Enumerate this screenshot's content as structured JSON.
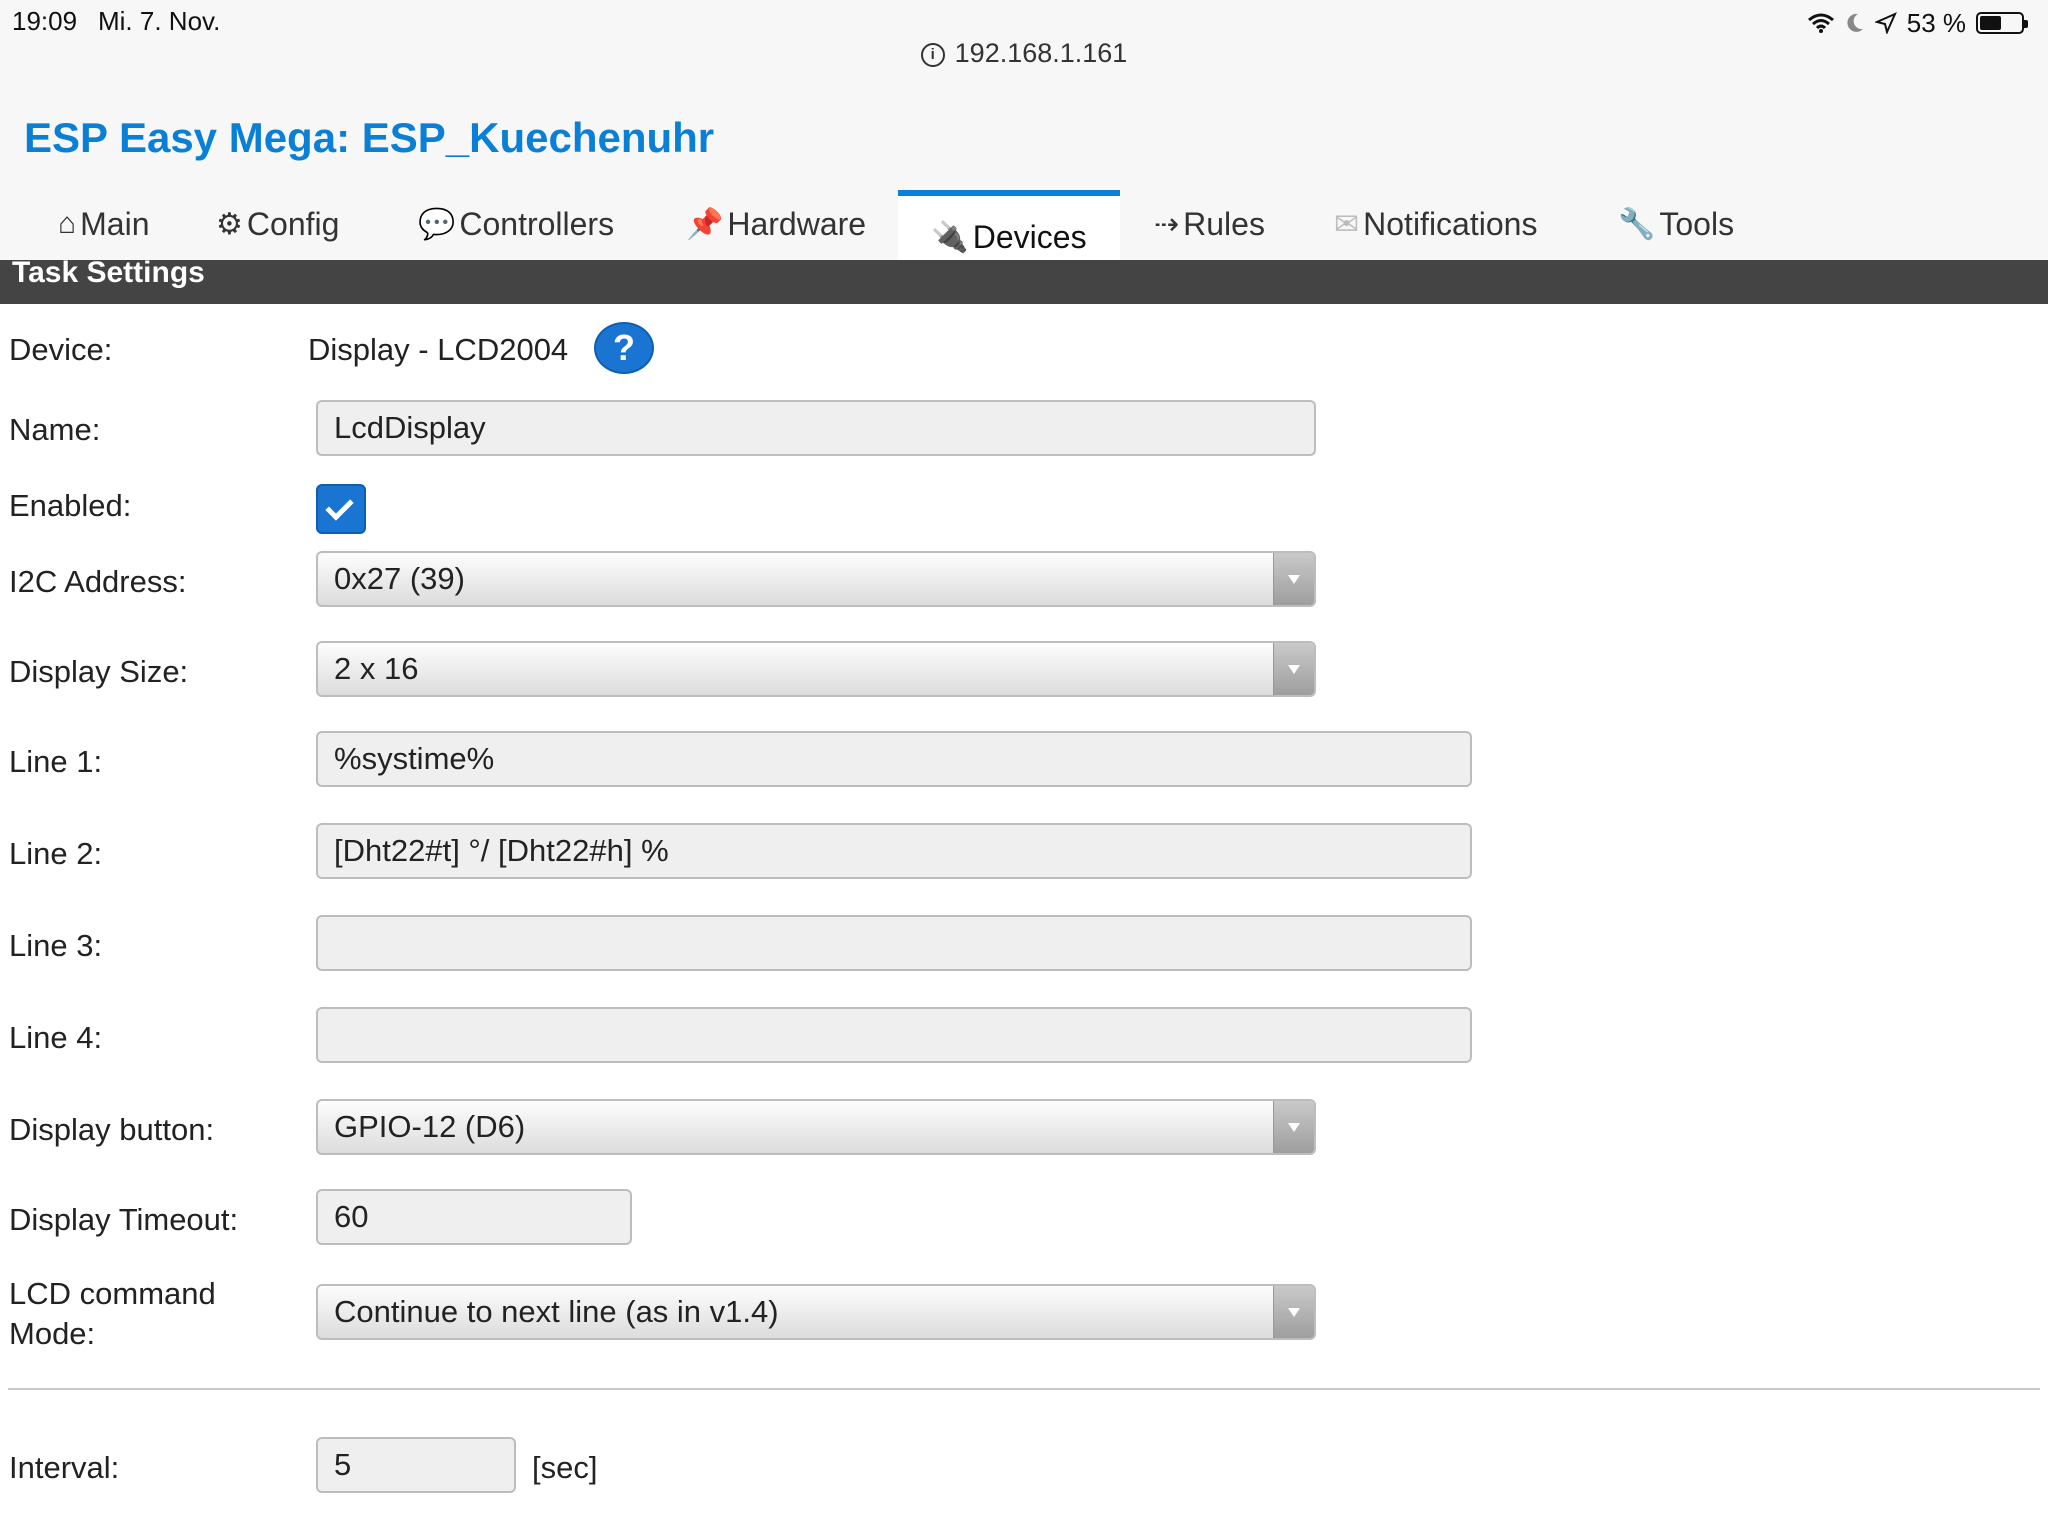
{
  "status_bar": {
    "time": "19:09",
    "date": "Mi. 7. Nov.",
    "battery": "53 %",
    "battery_level": 0.53,
    "icons": [
      "wifi-icon",
      "moon-icon",
      "location-arrow-icon",
      "battery-icon"
    ]
  },
  "url": "192.168.1.161",
  "app_title": "ESP Easy Mega: ESP_Kuechenuhr",
  "tabs": [
    {
      "label": "Main",
      "icon": "⌂"
    },
    {
      "label": "Config",
      "icon": "⚙"
    },
    {
      "label": "Controllers",
      "icon": "💬"
    },
    {
      "label": "Hardware",
      "icon": "📌"
    },
    {
      "label": "Devices",
      "icon": "🔌",
      "active": true
    },
    {
      "label": "Rules",
      "icon": "⇢"
    },
    {
      "label": "Notifications",
      "icon": "✉"
    },
    {
      "label": "Tools",
      "icon": "🔧"
    }
  ],
  "section_title": "Task Settings",
  "form": {
    "device": {
      "label": "Device:",
      "value": "Display - LCD2004",
      "help": "?"
    },
    "name": {
      "label": "Name:",
      "value": "LcdDisplay"
    },
    "enabled": {
      "label": "Enabled:",
      "checked": true
    },
    "i2c_address": {
      "label": "I2C Address:",
      "value": "0x27 (39)"
    },
    "display_size": {
      "label": "Display Size:",
      "value": "2 x 16"
    },
    "line1": {
      "label": "Line 1:",
      "value": "%systime%"
    },
    "line2": {
      "label": "Line 2:",
      "value": "[Dht22#t] °/ [Dht22#h] %"
    },
    "line3": {
      "label": "Line 3:",
      "value": ""
    },
    "line4": {
      "label": "Line 4:",
      "value": ""
    },
    "display_button": {
      "label": "Display button:",
      "value": "GPIO-12 (D6)"
    },
    "display_timeout": {
      "label": "Display Timeout:",
      "value": "60"
    },
    "lcd_command_mode": {
      "label_line1": "LCD command",
      "label_line2": "Mode:",
      "value": "Continue to next line (as in v1.4)"
    },
    "interval": {
      "label": "Interval:",
      "value": "5",
      "unit": "[sec]"
    }
  },
  "colors": {
    "accent": "#0a7fd6",
    "section_bar": "#444444",
    "checkbox": "#1a74d2"
  }
}
